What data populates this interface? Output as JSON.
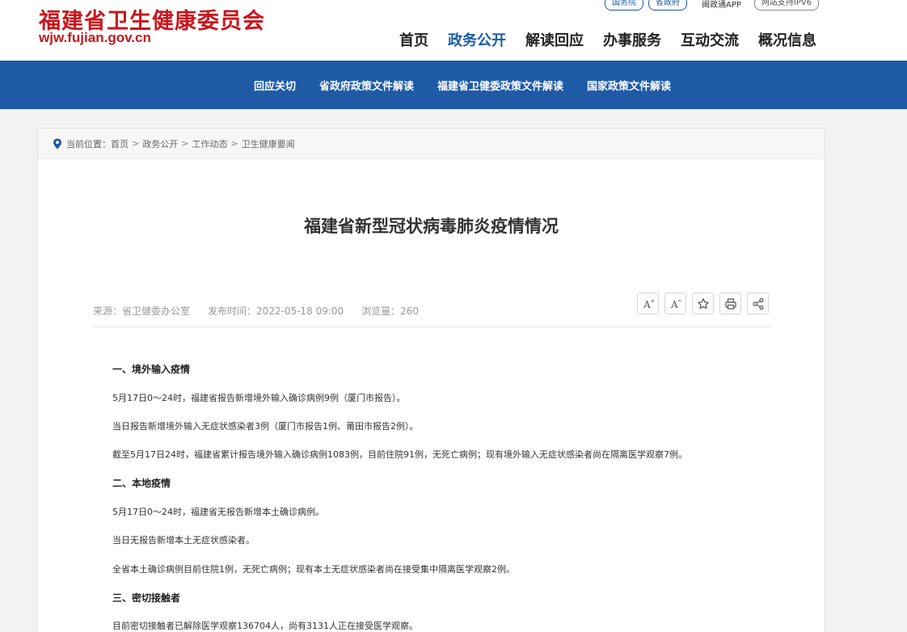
{
  "header": {
    "logo_cn": "福建省卫生健康委员会",
    "logo_en": "wjw.fujian.gov.cn",
    "top_links": {
      "guowuyuan": "国务院",
      "shengzhengfu": "省政府",
      "app": "闽政通APP",
      "ipv6": "网站支持IPV6"
    },
    "nav": [
      "首页",
      "政务公开",
      "解读回应",
      "办事服务",
      "互动交流",
      "概况信息"
    ],
    "active_nav": 1
  },
  "subnav": [
    "回应关切",
    "省政府政策文件解读",
    "福建省卫健委政策文件解读",
    "国家政策文件解读"
  ],
  "breadcrumb": {
    "prefix": "当前位置：",
    "items": [
      "首页",
      "政务公开",
      "工作动态",
      "卫生健康要闻"
    ],
    "separator": ">"
  },
  "article": {
    "title": "福建省新型冠状病毒肺炎疫情情况",
    "source": "来源：省卫健委办公室",
    "publish_time": "发布时间：2022-05-18 09:00",
    "views": "浏览量：260",
    "tools": [
      {
        "icon": "font-increase-icon",
        "label": "A+"
      },
      {
        "icon": "font-decrease-icon",
        "label": "A-"
      },
      {
        "icon": "star-icon",
        "label": ""
      },
      {
        "icon": "print-icon",
        "label": ""
      },
      {
        "icon": "share-icon",
        "label": ""
      }
    ],
    "paragraphs": [
      {
        "type": "heading",
        "text": "一、境外输入疫情"
      },
      {
        "type": "p",
        "text": "5月17日0～24时，福建省报告新增境外输入确诊病例9例（厦门市报告）。"
      },
      {
        "type": "p",
        "text": "当日报告新增境外输入无症状感染者3例（厦门市报告1例、莆田市报告2例）。"
      },
      {
        "type": "p",
        "text": "截至5月17日24时，福建省累计报告境外输入确诊病例1083例，目前住院91例，无死亡病例；现有境外输入无症状感染者尚在隔离医学观察7例。"
      },
      {
        "type": "heading",
        "text": "二、本地疫情"
      },
      {
        "type": "p",
        "text": "5月17日0～24时，福建省无报告新增本土确诊病例。"
      },
      {
        "type": "p",
        "text": "当日无报告新增本土无症状感染者。"
      },
      {
        "type": "p",
        "text": "全省本土确诊病例目前住院1例，无死亡病例；现有本土无症状感染者尚在接受集中隔离医学观察2例。"
      },
      {
        "type": "heading",
        "text": "三、密切接触者"
      },
      {
        "type": "p",
        "text": "目前密切接触者已解除医学观察136704人，尚有3131人正在接受医学观察。"
      }
    ]
  },
  "colors": {
    "brand_red": "#c8161d",
    "nav_blue": "#1f5aa6"
  }
}
